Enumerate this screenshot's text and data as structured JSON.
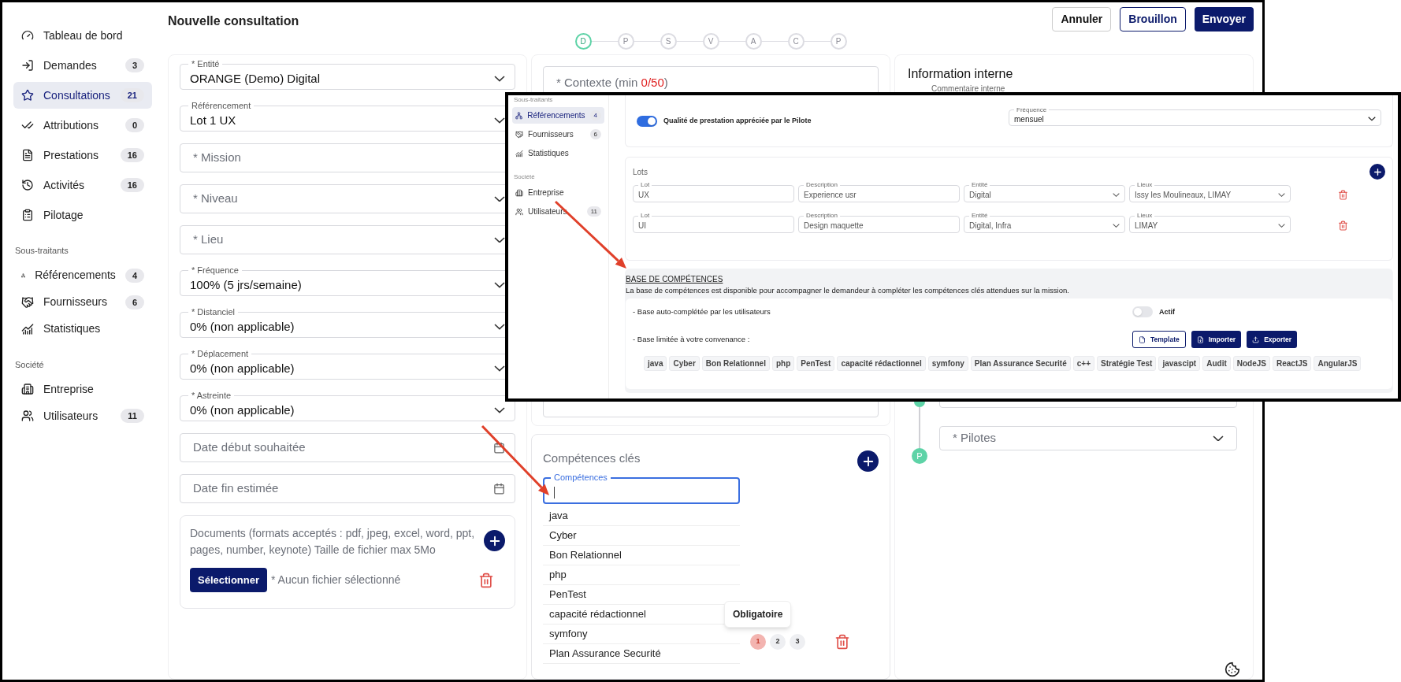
{
  "sidebar": {
    "items": [
      {
        "label": "Tableau de bord",
        "selected": false
      },
      {
        "label": "Demandes",
        "count": "3",
        "selected": false
      },
      {
        "label": "Consultations",
        "count": "21",
        "selected": true
      },
      {
        "label": "Attributions",
        "count": "0",
        "selected": false
      },
      {
        "label": "Prestations",
        "count": "16",
        "selected": false
      },
      {
        "label": "Activités",
        "count": "16",
        "selected": false
      },
      {
        "label": "Pilotage",
        "selected": false
      }
    ],
    "sections": [
      {
        "heading": "Sous-traitants",
        "items": [
          {
            "label": "Référencements",
            "count": "4",
            "selected": false
          },
          {
            "label": "Fournisseurs",
            "count": "6",
            "selected": false
          },
          {
            "label": "Statistiques",
            "selected": false
          }
        ]
      },
      {
        "heading": "Société",
        "items": [
          {
            "label": "Entreprise",
            "selected": false
          },
          {
            "label": "Utilisateurs",
            "count": "11",
            "selected": false
          }
        ]
      }
    ]
  },
  "header": {
    "title": "Nouvelle consultation",
    "buttons": [
      {
        "label": "Annuler",
        "kind": "plain"
      },
      {
        "label": "Brouillon",
        "kind": "outline"
      },
      {
        "label": "Envoyer",
        "kind": "primary"
      }
    ]
  },
  "stepper": [
    {
      "letter": "D",
      "selected": true
    },
    {
      "letter": "P",
      "selected": false
    },
    {
      "letter": "S",
      "selected": false
    },
    {
      "letter": "V",
      "selected": false
    },
    {
      "letter": "A",
      "selected": false
    },
    {
      "letter": "C",
      "selected": false
    },
    {
      "letter": "P",
      "selected": false
    }
  ],
  "general": {
    "fields": [
      {
        "kind": "select",
        "label": "* Entité",
        "value": "ORANGE (Demo) Digital"
      },
      {
        "kind": "select",
        "label": "Référencement",
        "value": "Lot 1 UX"
      },
      {
        "kind": "text",
        "placeholder": "* Mission"
      },
      {
        "kind": "select",
        "placeholder": "* Niveau"
      },
      {
        "kind": "select",
        "placeholder": "* Lieu"
      },
      {
        "kind": "select",
        "label": "* Fréquence",
        "value": "100% (5 jrs/semaine)"
      },
      {
        "kind": "select",
        "label": "* Distanciel",
        "value": "0% (non applicable)"
      },
      {
        "kind": "select",
        "label": "* Déplacement",
        "value": "0% (non applicable)"
      },
      {
        "kind": "select",
        "label": "* Astreinte",
        "value": "0% (non applicable)"
      },
      {
        "kind": "date",
        "placeholder": "Date début souhaitée"
      },
      {
        "kind": "date",
        "placeholder": "Date fin estimée"
      }
    ],
    "documents": {
      "text": "Documents (formats acceptés : pdf, jpeg, excel, word, ppt, pages, number, keynote) Taille de fichier max 5Mo",
      "button": "Sélectionner",
      "status": "* Aucun fichier sélectionné"
    }
  },
  "context": {
    "label": "* Contexte (min ",
    "count": "0/50",
    "suffix": ")"
  },
  "skills": {
    "title": "Compétences clés",
    "input_label": "Compétences",
    "options": [
      "java",
      "Cyber",
      "Bon Relationnel",
      "php",
      "PenTest",
      "capacité rédactionnel",
      "symfony",
      "Plan Assurance Securité"
    ],
    "tooltip": "Obligatoire",
    "levels": [
      {
        "label": "1",
        "selected": true
      },
      {
        "label": "2",
        "selected": false
      },
      {
        "label": "3",
        "selected": false
      }
    ]
  },
  "internal": {
    "title": "Information interne",
    "comment_label": "Commentaire interne",
    "pilot_marker": "P",
    "pilots_placeholder": "* Pilotes"
  },
  "inset": {
    "sidebar": {
      "sections": [
        {
          "heading": "Sous-traitants",
          "items": [
            {
              "label": "Référencements",
              "count": "4",
              "selected": true
            },
            {
              "label": "Fournisseurs",
              "count": "6",
              "selected": false
            },
            {
              "label": "Statistiques",
              "selected": false
            }
          ]
        },
        {
          "heading": "Société",
          "items": [
            {
              "label": "Entreprise",
              "selected": false
            },
            {
              "label": "Utilisateurs",
              "count": "11",
              "selected": false
            }
          ]
        }
      ]
    },
    "quality": {
      "label": "Qualité de prestation appréciée par le Pilote",
      "on": true
    },
    "frequency": {
      "label": "Fréquence",
      "value": "mensuel"
    },
    "lots": {
      "title": "Lots",
      "rows": [
        {
          "fields": [
            {
              "kind": "input",
              "label": "Lot",
              "value": "UX"
            },
            {
              "kind": "input",
              "label": "Description",
              "value": "Experience usr"
            },
            {
              "kind": "select",
              "label": "Entité",
              "value": "Digital"
            },
            {
              "kind": "select",
              "label": "Lieux",
              "value": "Issy les Moulineaux, LIMAY"
            }
          ]
        },
        {
          "fields": [
            {
              "kind": "input",
              "label": "Lot",
              "value": "UI"
            },
            {
              "kind": "input",
              "label": "Description",
              "value": "Design maquette"
            },
            {
              "kind": "select",
              "label": "Entité",
              "value": "Digital, Infra"
            },
            {
              "kind": "select",
              "label": "Lieux",
              "value": "LIMAY"
            }
          ]
        }
      ]
    },
    "base": {
      "title": "BASE DE COMPÉTENCES",
      "description": "La base de compétences est disponible pour accompagner le demandeur à compléter les compétences clés attendues sur la mission.",
      "auto": {
        "label": "- Base auto-complétée par les utilisateurs",
        "toggle_label": "Actif",
        "on": false
      },
      "limited": {
        "label": "- Base limitée à votre convenance :",
        "buttons": [
          {
            "label": "Template",
            "kind": "outline"
          },
          {
            "label": "Importer",
            "kind": "primary"
          },
          {
            "label": "Exporter",
            "kind": "primary"
          }
        ]
      },
      "tags": [
        "java",
        "Cyber",
        "Bon Relationnel",
        "php",
        "PenTest",
        "capacité rédactionnel",
        "symfony",
        "Plan Assurance Securité",
        "c++",
        "Stratégie Test",
        "javascipt",
        "Audit",
        "NodeJS",
        "ReactJS",
        "AngularJS"
      ]
    }
  }
}
